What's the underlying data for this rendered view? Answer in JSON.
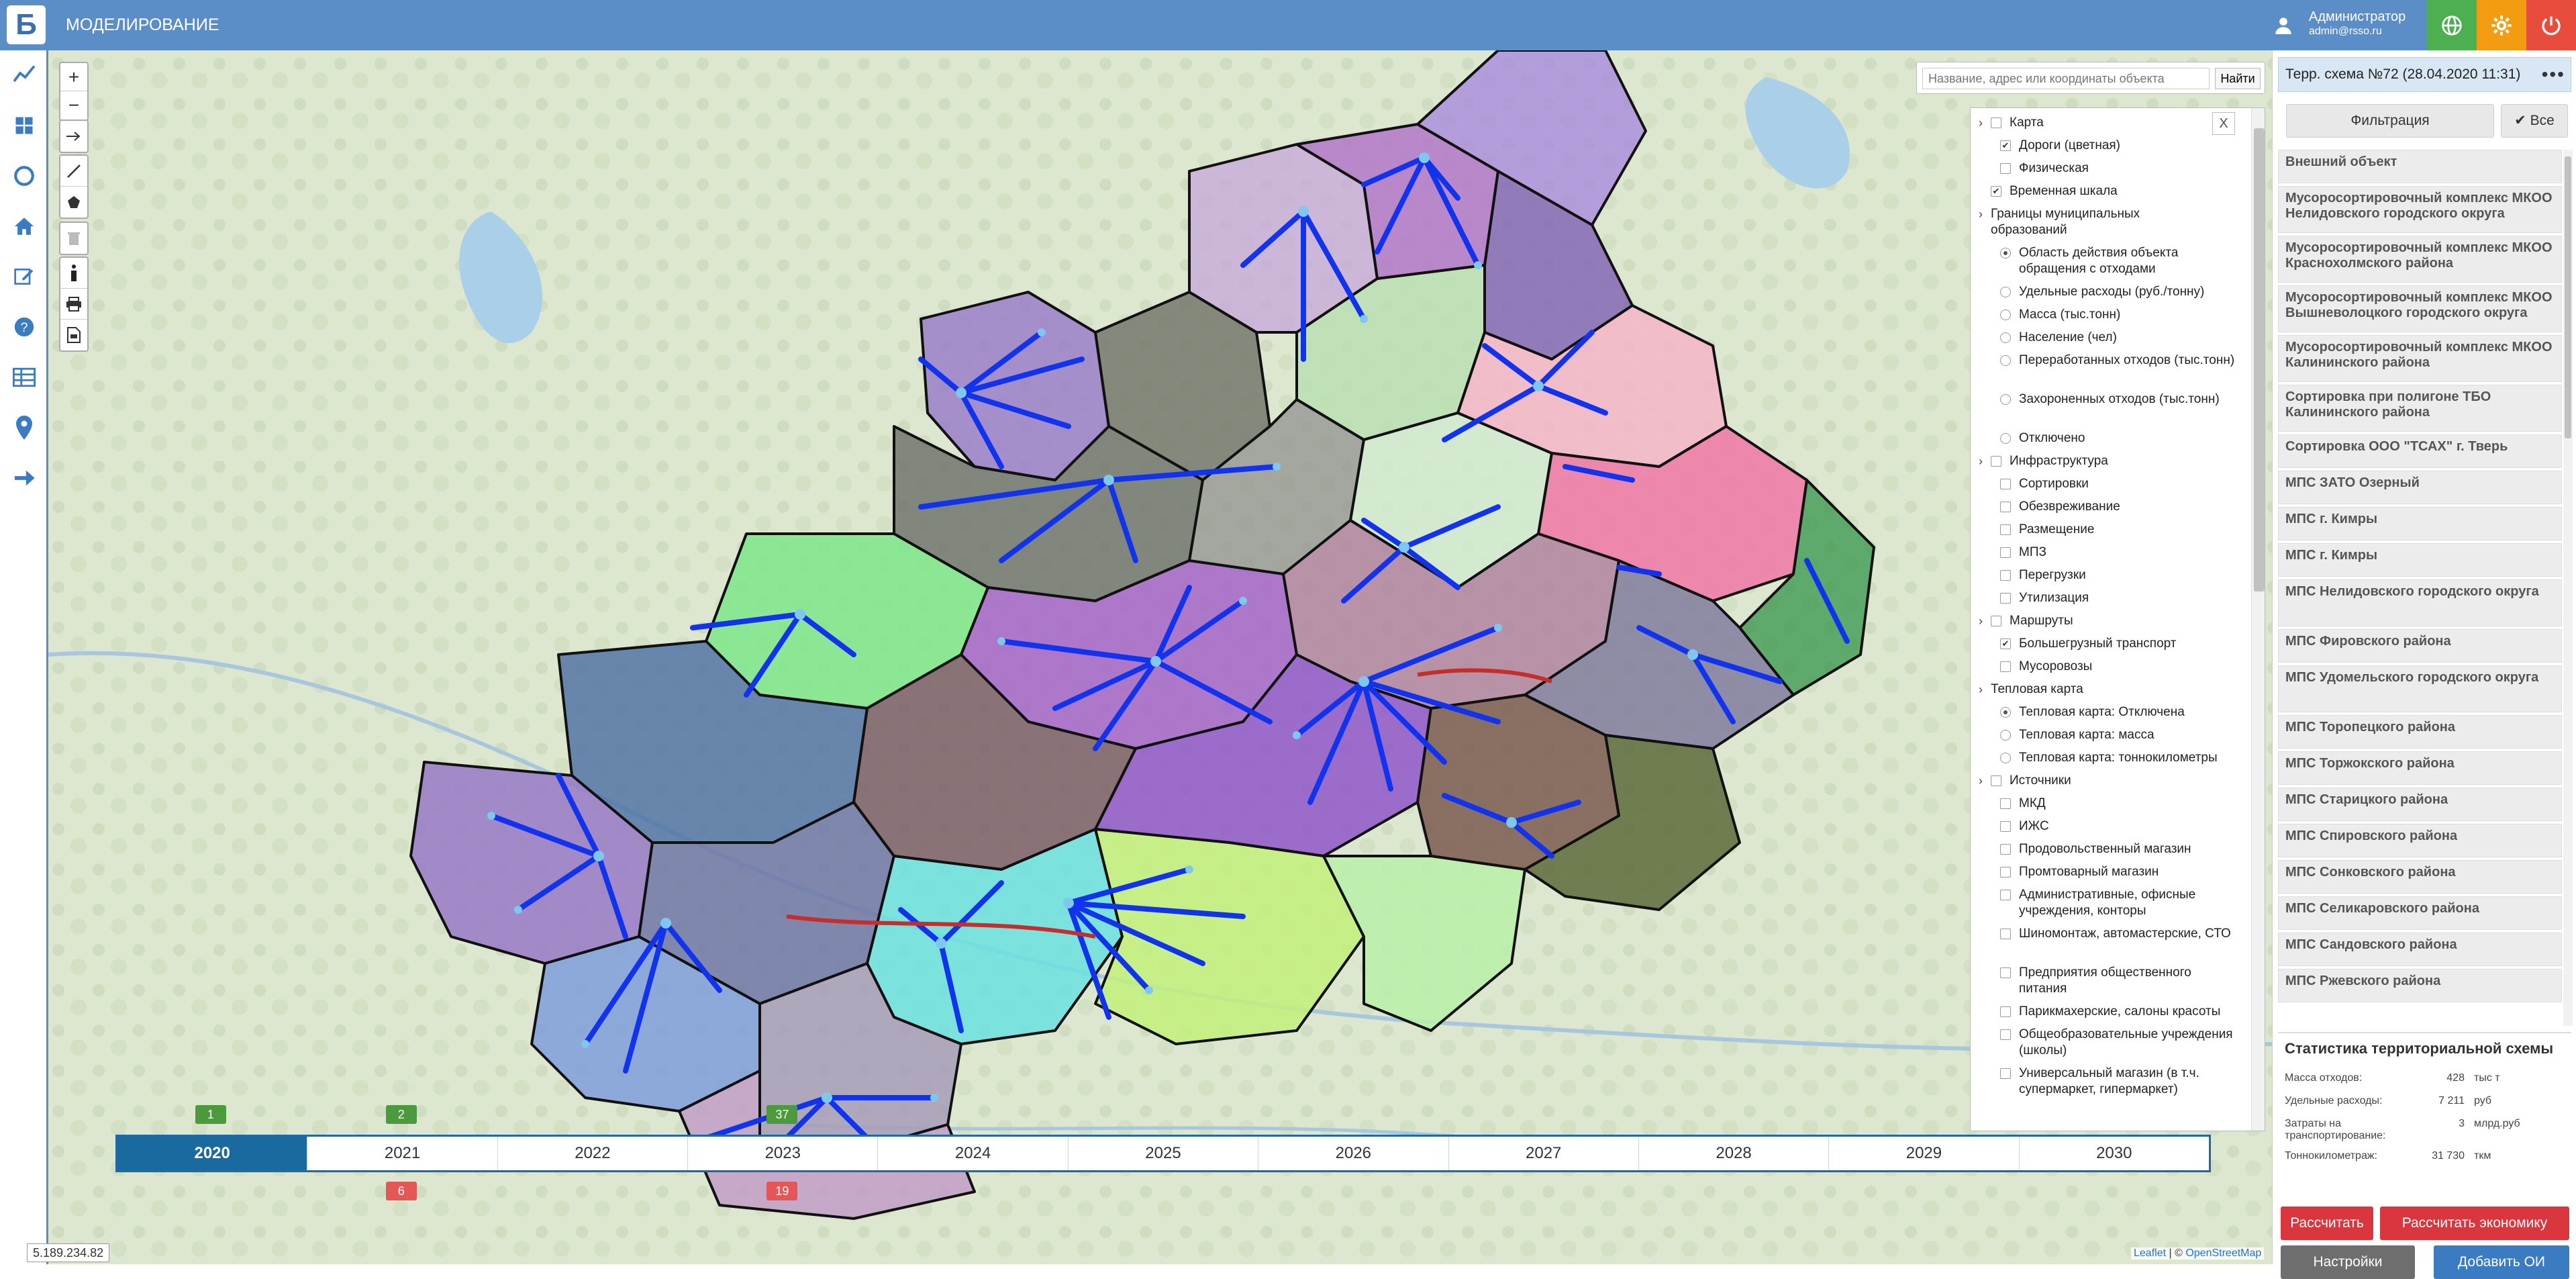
{
  "app": {
    "title": "МОДЕЛИРОВАНИЕ",
    "logo_letter": "Б",
    "user_name": "Администратор",
    "user_email": "admin@rsso.ru",
    "colors": {
      "topbar": "#5b8ec7",
      "green_btn": "#4caf50",
      "orange_btn": "#f39c12",
      "red_btn": "#e74c3c"
    }
  },
  "leftbar": {
    "icons": [
      "chart-line-icon",
      "grid-icon",
      "ring-icon",
      "home-icon",
      "edit-icon",
      "help-icon",
      "table-icon",
      "map-pin-icon",
      "arrow-right-icon"
    ]
  },
  "map": {
    "search_placeholder": "Название, адрес или координаты объекта",
    "search_button": "Найти",
    "close_label": "X",
    "coords": "5.189.234.82",
    "attribution_leaflet": "Leaflet",
    "attribution_sep": " | © ",
    "attribution_osm": "OpenStreetMap"
  },
  "layers": [
    {
      "type": "group",
      "label": "Карта",
      "checked": false
    },
    {
      "type": "check",
      "label": "Дороги (цветная)",
      "checked": true
    },
    {
      "type": "check",
      "label": "Физическая",
      "checked": false
    },
    {
      "type": "group-check",
      "label": "Временная шкала",
      "checked": true
    },
    {
      "type": "group",
      "label": "Границы муниципальных образований",
      "checked": null
    },
    {
      "type": "radio",
      "label": "Область действия объекта обращения с отходами",
      "checked": true
    },
    {
      "type": "radio",
      "label": "Удельные расходы (руб./тонну)",
      "checked": false
    },
    {
      "type": "radio",
      "label": "Масса (тыс.тонн)",
      "checked": false
    },
    {
      "type": "radio",
      "label": "Население (чел)",
      "checked": false
    },
    {
      "type": "radio",
      "label": "Переработанных отходов (тыс.тонн)",
      "checked": false
    },
    {
      "type": "radio",
      "label": "Захороненных отходов (тыс.тонн)",
      "checked": false
    },
    {
      "type": "radio",
      "label": "Отключено",
      "checked": false
    },
    {
      "type": "group",
      "label": "Инфраструктура",
      "checked": false
    },
    {
      "type": "check",
      "label": "Сортировки",
      "checked": false
    },
    {
      "type": "check",
      "label": "Обезвреживание",
      "checked": false
    },
    {
      "type": "check",
      "label": "Размещение",
      "checked": false
    },
    {
      "type": "check",
      "label": "МПЗ",
      "checked": false
    },
    {
      "type": "check",
      "label": "Перегрузки",
      "checked": false
    },
    {
      "type": "check",
      "label": "Утилизация",
      "checked": false
    },
    {
      "type": "group",
      "label": "Маршруты",
      "checked": false
    },
    {
      "type": "check",
      "label": "Большегрузный транспорт",
      "checked": true
    },
    {
      "type": "check",
      "label": "Мусоровозы",
      "checked": false
    },
    {
      "type": "group",
      "label": "Тепловая карта",
      "checked": null
    },
    {
      "type": "radio",
      "label": "Тепловая карта: Отключена",
      "checked": true
    },
    {
      "type": "radio",
      "label": "Тепловая карта: масса",
      "checked": false
    },
    {
      "type": "radio",
      "label": "Тепловая карта: тоннокилометры",
      "checked": false
    },
    {
      "type": "group",
      "label": "Источники",
      "checked": false
    },
    {
      "type": "check",
      "label": "МКД",
      "checked": false
    },
    {
      "type": "check",
      "label": "ИЖС",
      "checked": false
    },
    {
      "type": "check",
      "label": "Продовольственный магазин",
      "checked": false
    },
    {
      "type": "check",
      "label": "Промтоварный магазин",
      "checked": false
    },
    {
      "type": "check",
      "label": "Административные, офисные учреждения, конторы",
      "checked": false
    },
    {
      "type": "check",
      "label": "Шиномонтаж, автомастерские, СТО",
      "checked": false
    },
    {
      "type": "check",
      "label": "Предприятия общественного питания",
      "checked": false
    },
    {
      "type": "check",
      "label": "Парикмахерские, салоны красоты",
      "checked": false
    },
    {
      "type": "check",
      "label": "Общеобразовательные учреждения (школы)",
      "checked": false
    },
    {
      "type": "check",
      "label": "Универсальный магазин (в т.ч. супермаркет, гипермаркет)",
      "checked": false
    }
  ],
  "timeline": {
    "years": [
      "2020",
      "2021",
      "2022",
      "2023",
      "2024",
      "2025",
      "2026",
      "2027",
      "2028",
      "2029",
      "2030"
    ],
    "active": "2020",
    "green_badges": [
      {
        "year": "2020",
        "value": "1"
      },
      {
        "year": "2021",
        "value": "2"
      },
      {
        "year": "2023",
        "value": "37"
      }
    ],
    "red_badges": [
      {
        "year": "2021",
        "value": "6"
      },
      {
        "year": "2023",
        "value": "19"
      }
    ]
  },
  "right": {
    "scheme_title": "Терр. схема №72 (28.04.2020 11:31)",
    "scheme_menu": "•••",
    "filter_label": "Фильтрация",
    "all_label": "✔ Все",
    "objects": [
      "Внешний объект",
      "Мусоросортировочный комплекс МКОО Нелидовского городского округа",
      "Мусоросортировочный комплекс МКОО Краснохолмского района",
      "Мусоросортировочный комплекс МКОО Вышневолоцкого городского округа",
      "Мусоросортировочный комплекс МКОО Калининского района",
      "Сортировка при полигоне ТБО Калининского района",
      "Сортировка ООО \"ТСАХ\" г. Тверь",
      "МПС ЗАТО Озерный",
      "МПС г. Кимры",
      "МПС г. Кимры",
      "МПС Нелидовского городского округа",
      "МПС Фировского района",
      "МПС Удомельского городского округа",
      "МПС Торопецкого района",
      "МПС Торжокского района",
      "МПС Старицкого района",
      "МПС Спировского района",
      "МПС Сонковского района",
      "МПС Селикаровского района",
      "МПС Сандовского района",
      "МПС Ржевского района"
    ],
    "stats_title": "Статистика территориальной схемы",
    "stats": [
      {
        "label": "Масса отходов:",
        "value": "428",
        "unit": "тыс т"
      },
      {
        "label": "Удельные расходы:",
        "value": "7 211",
        "unit": "руб"
      },
      {
        "label": "Затраты на транспортирование:",
        "value": "3",
        "unit": "млрд.руб"
      },
      {
        "label": "Тоннокилометраж:",
        "value": "31 730",
        "unit": "ткм"
      }
    ],
    "btn_calc": "Рассчитать",
    "btn_econ": "Рассчитать экономику",
    "btn_settings": "Настройки",
    "btn_add": "Добавить ОИ"
  }
}
